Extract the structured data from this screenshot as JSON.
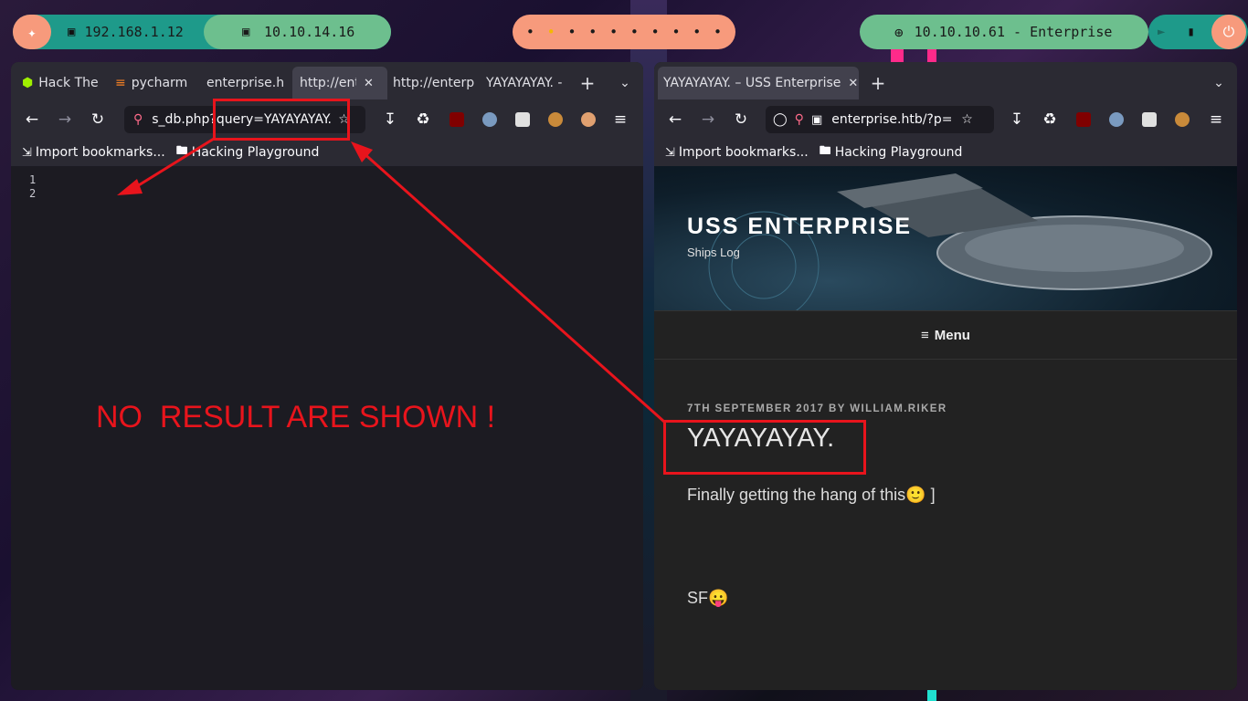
{
  "topbar": {
    "ip_local": "192.168.1.12",
    "ip_vpn": "10.10.14.16",
    "target": "10.10.10.61 - Enterprise"
  },
  "left_window": {
    "tabs": [
      {
        "label": "Hack The"
      },
      {
        "label": "pycharm"
      },
      {
        "label": "enterprise.h"
      },
      {
        "label": "http://ent"
      },
      {
        "label": "http://enterp"
      },
      {
        "label": "YAYAYAYAY. -"
      }
    ],
    "url": "s_db.php?query=YAYAYAYAY.",
    "bookmarks": {
      "import": "Import bookmarks...",
      "folder": "Hacking Playground"
    },
    "lines": [
      "1",
      "2"
    ]
  },
  "right_window": {
    "tab_label": "YAYAYAYAY. – USS Enterprise",
    "url": "enterprise.htb/?p=",
    "bookmarks": {
      "import": "Import bookmarks...",
      "folder": "Hacking Playground"
    },
    "site_title": "USS ENTERPRISE",
    "site_tagline": "Ships Log",
    "menu_label": "Menu",
    "post_meta": "7TH SEPTEMBER 2017 BY WILLIAM.RIKER",
    "post_title": "YAYAYAYAY.",
    "post_body": "Finally getting the hang of this🙂 ]",
    "post_body2": "SF😛"
  },
  "annotation": {
    "text": "NO  RESULT ARE SHOWN !",
    "color": "#e8141c"
  },
  "colors": {
    "accent_red": "#e8141c",
    "pill_salmon": "#f79a7c",
    "pill_green": "#6dbf8e",
    "pill_teal": "#1e9a8a"
  }
}
